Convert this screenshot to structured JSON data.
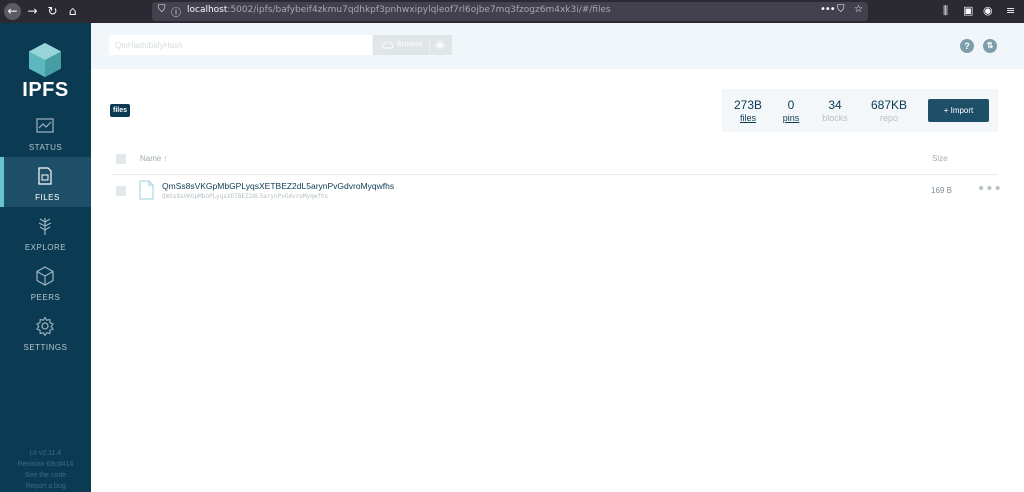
{
  "browser": {
    "url_host": "localhost",
    "url_rest": ":5002/ipfs/bafybeif4zkmu7qdhkpf3pnhwxipylqleof7rl6ojbe7mq3fzogz6m4xk3i/#/files"
  },
  "sidebar": {
    "logo": "IPFS",
    "items": [
      {
        "label": "STATUS",
        "icon": "status-icon"
      },
      {
        "label": "FILES",
        "icon": "files-icon",
        "active": true
      },
      {
        "label": "EXPLORE",
        "icon": "explore-icon"
      },
      {
        "label": "PEERS",
        "icon": "peers-icon"
      },
      {
        "label": "SETTINGS",
        "icon": "settings-icon"
      }
    ],
    "footer": {
      "version": "UI v2.11.4",
      "revision": "Revision 69cd414",
      "see_code": "See the code",
      "report_bug": "Report a bug"
    }
  },
  "topbar": {
    "search_placeholder": "QmHash/bafyHash",
    "browse_label": "Browse"
  },
  "breadcrumb": "files",
  "stats": [
    {
      "value": "273B",
      "label": "files"
    },
    {
      "value": "0",
      "label": "pins"
    },
    {
      "value": "34",
      "label": "blocks"
    },
    {
      "value": "687KB",
      "label": "repo"
    }
  ],
  "import_label": "+ Import",
  "table": {
    "name_header": "Name ↑",
    "size_header": "Size",
    "rows": [
      {
        "name": "QmSs8sVKGpMbGPLyqsXETBEZ2dL5arynPvGdvroMyqwfhs",
        "cid": "QmSs8sVKGpMbGPLyqsXETBEZ2dL5arynPvGdvroMyqwfhs",
        "size": "169 B"
      }
    ]
  },
  "colors": {
    "sidebar": "#0b3a53",
    "active_nav": "#1e4f68",
    "accent": "#69c4cd"
  }
}
